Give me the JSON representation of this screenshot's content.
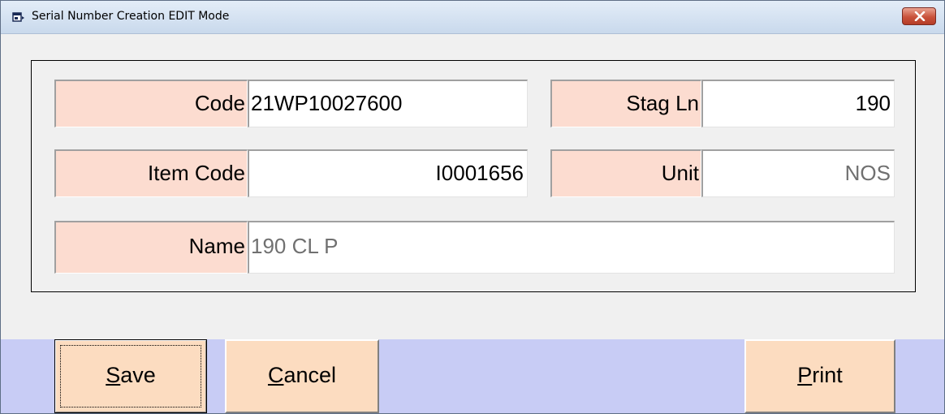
{
  "window": {
    "title": "Serial Number Creation EDIT Mode",
    "icon": "app-window-icon",
    "close_icon": "close-x-icon"
  },
  "form": {
    "code": {
      "label": "Code",
      "value": "21WP10027600"
    },
    "stag_ln": {
      "label": "Stag Ln",
      "value": "190"
    },
    "item_code": {
      "label": "Item Code",
      "value": "I0001656"
    },
    "unit": {
      "label": "Unit",
      "value": "NOS"
    },
    "name": {
      "label": "Name",
      "value": "190 CL P"
    }
  },
  "buttons": {
    "save": {
      "accel": "S",
      "rest": "ave"
    },
    "cancel": {
      "accel": "C",
      "rest": "ancel"
    },
    "print": {
      "accel": "P",
      "rest": "rint"
    }
  },
  "colors": {
    "label_bg": "#fcdcd0",
    "button_bg": "#fcdcc0",
    "button_bar_bg": "#c8ccf5",
    "readonly_text": "#707070"
  }
}
